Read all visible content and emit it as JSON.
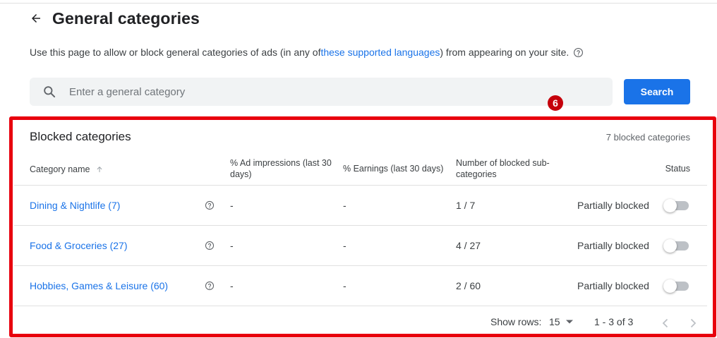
{
  "header": {
    "title": "General categories",
    "back_icon": "arrow-back-icon"
  },
  "intro": {
    "text_before": "Use this page to allow or block general categories of ads (in any of ",
    "link_text": "these supported languages",
    "text_after": ") from appearing on your site.",
    "help_icon": "help-circle-icon"
  },
  "search": {
    "placeholder": "Enter a general category",
    "icon": "search-icon",
    "button_label": "Search",
    "button_color": "#1a73e8"
  },
  "annotation": {
    "step_number": "6",
    "frame_color": "#e8000d"
  },
  "table": {
    "title": "Blocked categories",
    "count_label": "7 blocked categories",
    "columns": {
      "category": "Category name",
      "impressions": "% Ad impressions (last 30 days)",
      "earnings": "% Earnings (last 30 days)",
      "subcategories": "Number of blocked sub-categories",
      "status": "Status"
    },
    "rows": [
      {
        "name": "Dining & Nightlife (7)",
        "impressions": "-",
        "earnings": "-",
        "subcategories": "1 / 7",
        "status": "Partially blocked",
        "toggle_on": false
      },
      {
        "name": "Food & Groceries (27)",
        "impressions": "-",
        "earnings": "-",
        "subcategories": "4 / 27",
        "status": "Partially blocked",
        "toggle_on": false
      },
      {
        "name": "Hobbies, Games & Leisure (60)",
        "impressions": "-",
        "earnings": "-",
        "subcategories": "2 / 60",
        "status": "Partially blocked",
        "toggle_on": false
      }
    ]
  },
  "pagination": {
    "rows_label": "Show rows:",
    "rows_value": "15",
    "range": "1 - 3 of 3"
  }
}
